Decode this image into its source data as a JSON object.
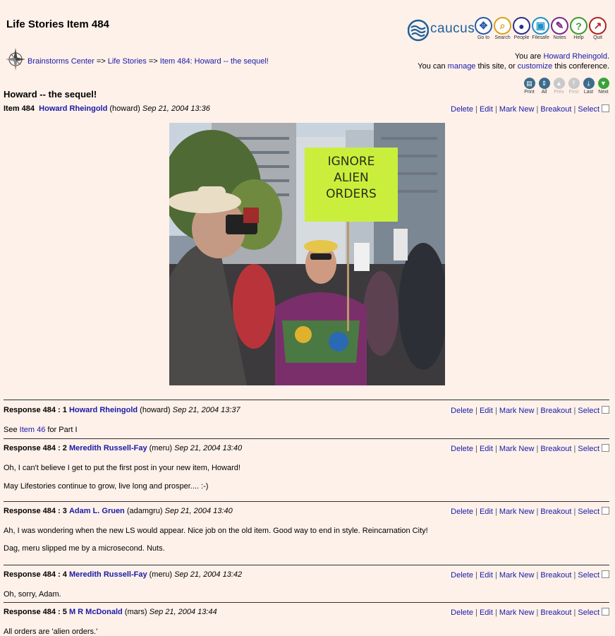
{
  "page": {
    "title": "Life Stories Item 484"
  },
  "logo": {
    "text": "caucus"
  },
  "toolbar": [
    {
      "label": "Go to",
      "icon": "goto-icon",
      "color": "#2a5aa8",
      "glyph": "✥"
    },
    {
      "label": "Search",
      "icon": "search-icon",
      "color": "#d9a21b",
      "glyph": "⌕"
    },
    {
      "label": "People",
      "icon": "people-icon",
      "color": "#2b2f8a",
      "glyph": "●"
    },
    {
      "label": "Filesafe",
      "icon": "filesafe-icon",
      "color": "#1d8fc9",
      "glyph": "▣"
    },
    {
      "label": "Notes",
      "icon": "notes-icon",
      "color": "#7b2a86",
      "glyph": "✎"
    },
    {
      "label": "Help",
      "icon": "help-icon",
      "color": "#3f9a2a",
      "glyph": "?"
    },
    {
      "label": "Quit",
      "icon": "quit-icon",
      "color": "#b3221f",
      "glyph": "↗"
    }
  ],
  "breadcrumb": {
    "items": [
      "Brainstorms Center",
      "Life Stories",
      "Item 484: Howard -- the sequel!"
    ],
    "separator": "=>"
  },
  "user": {
    "you_are": "You are",
    "name": "Howard Rheingold",
    "period": ".",
    "can_prefix": "You can",
    "manage": "manage",
    "mid": "this site, or",
    "customize": "customize",
    "suffix": "this conference."
  },
  "item": {
    "heading": "Howard -- the sequel!",
    "label": "Item 484",
    "author": "Howard Rheingold",
    "userid": "(howard)",
    "date": "Sep 21, 2004 13:36",
    "photo_sign": [
      "IGNORE",
      "ALIEN",
      "ORDERS"
    ]
  },
  "nav": [
    {
      "label": "Print",
      "icon": "print-icon",
      "color": "#3d6c8a",
      "glyph": "▤",
      "enabled": true
    },
    {
      "label": "All",
      "icon": "all-icon",
      "color": "#3d6c8a",
      "glyph": "⇕",
      "enabled": true
    },
    {
      "label": "Prev",
      "icon": "prev-icon",
      "color": "#c9c9c9",
      "glyph": "▲",
      "enabled": false
    },
    {
      "label": "First",
      "icon": "first-icon",
      "color": "#c9c9c9",
      "glyph": "⤒",
      "enabled": false
    },
    {
      "label": "Last",
      "icon": "last-icon",
      "color": "#3d6c8a",
      "glyph": "⤓",
      "enabled": true
    },
    {
      "label": "Next",
      "icon": "next-icon",
      "color": "#3aa33a",
      "glyph": "▼",
      "enabled": true
    }
  ],
  "actions": {
    "delete": "Delete",
    "edit": "Edit",
    "mark_new": "Mark New",
    "breakout": "Breakout",
    "select": "Select",
    "sep": "|"
  },
  "responses": [
    {
      "label": "Response 484 : 1",
      "author": "Howard Rheingold",
      "userid": "(howard)",
      "date": "Sep 21, 2004 13:37",
      "lines": [
        {
          "pre": "See ",
          "link": "Item 46",
          "post": " for Part I"
        }
      ]
    },
    {
      "label": "Response 484 : 2",
      "author": "Meredith Russell-Fay",
      "userid": "(meru)",
      "date": "Sep 21, 2004 13:40",
      "lines": [
        {
          "pre": "Oh, I can't believe I get to put the first post in your new item, Howard!"
        },
        {
          "pre": "May Lifestories continue to grow, live long and prosper....  :-)"
        }
      ]
    },
    {
      "label": "Response 484 : 3",
      "author": "Adam L. Gruen",
      "userid": "(adamgru)",
      "date": "Sep 21, 2004 13:40",
      "lines": [
        {
          "pre": "Ah, I was wondering when the new LS would appear. Nice job on the old item. Good way to end in style. Reincarnation City!"
        },
        {
          "pre": "Dag, meru slipped me by a microsecond. Nuts."
        }
      ]
    },
    {
      "label": "Response 484 : 4",
      "author": "Meredith Russell-Fay",
      "userid": "(meru)",
      "date": "Sep 21, 2004 13:42",
      "lines": [
        {
          "pre": "Oh, sorry, Adam."
        }
      ]
    },
    {
      "label": "Response 484 : 5",
      "author": "M R McDonald",
      "userid": "(mars)",
      "date": "Sep 21, 2004 13:44",
      "lines": [
        {
          "pre": "All orders are 'alien orders.'"
        }
      ]
    }
  ]
}
